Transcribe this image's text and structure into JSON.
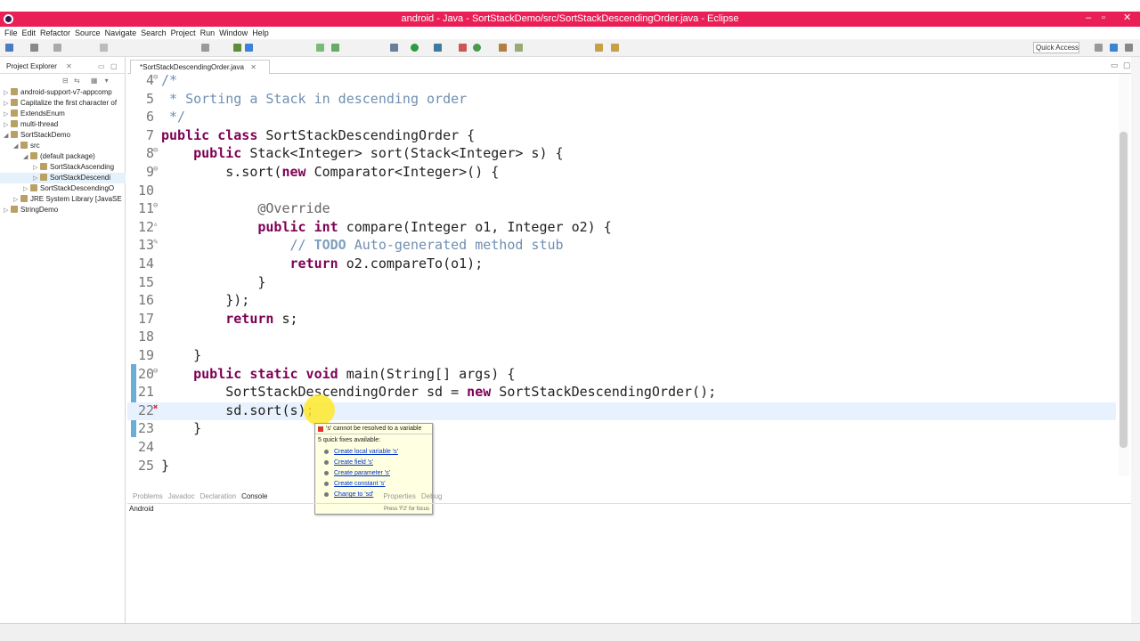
{
  "window": {
    "title": "android - Java - SortStackDemo/src/SortStackDescendingOrder.java - Eclipse",
    "minimize": "–",
    "maximize": "▫",
    "close": "✕"
  },
  "menu": [
    "File",
    "Edit",
    "Refactor",
    "Source",
    "Navigate",
    "Search",
    "Project",
    "Run",
    "Window",
    "Help"
  ],
  "quick_access": "Quick Access",
  "project_explorer": {
    "tab": "Project Explorer",
    "items": [
      {
        "label": "android-support-v7-appcomp",
        "indent": 1
      },
      {
        "label": "Capitalize the first character of",
        "indent": 1
      },
      {
        "label": "ExtendsEnum",
        "indent": 1
      },
      {
        "label": "multi-thread",
        "indent": 1
      },
      {
        "label": "SortStackDemo",
        "indent": 1
      },
      {
        "label": "src",
        "indent": 2
      },
      {
        "label": "(default package)",
        "indent": 3
      },
      {
        "label": "SortStackAscending",
        "indent": 4
      },
      {
        "label": "SortStackDescendi",
        "indent": 4
      },
      {
        "label": "SortStackDescendingO",
        "indent": 3
      },
      {
        "label": "JRE System Library [JavaSE",
        "indent": 2
      },
      {
        "label": "StringDemo",
        "indent": 1
      }
    ]
  },
  "editor": {
    "tab": "*SortStackDescendingOrder.java",
    "lines": [
      {
        "n": "4",
        "marker": "⊖",
        "html": "/*",
        "cls": "c"
      },
      {
        "n": "5",
        "html": " * Sorting a Stack in descending order",
        "cls": "c"
      },
      {
        "n": "6",
        "html": " */",
        "cls": "c"
      },
      {
        "n": "7",
        "parts": [
          [
            "k",
            "public class "
          ],
          [
            "",
            "SortStackDescendingOrder {"
          ]
        ]
      },
      {
        "n": "8",
        "marker": "⊖",
        "parts": [
          [
            "",
            "    "
          ],
          [
            "k",
            "public "
          ],
          [
            "",
            "Stack<Integer> sort(Stack<Integer> s) {"
          ]
        ]
      },
      {
        "n": "9",
        "marker": "⊖",
        "parts": [
          [
            "",
            "        s.sort("
          ],
          [
            "k",
            "new "
          ],
          [
            "",
            "Comparator<Integer>() {"
          ]
        ]
      },
      {
        "n": "10",
        "parts": []
      },
      {
        "n": "11",
        "marker": "⊖",
        "parts": [
          [
            "a",
            "            @Override"
          ]
        ]
      },
      {
        "n": "12",
        "marker": "▵",
        "parts": [
          [
            "",
            "            "
          ],
          [
            "k",
            "public int "
          ],
          [
            "",
            "compare(Integer o1, Integer o2) {"
          ]
        ]
      },
      {
        "n": "13",
        "marker": "✎",
        "parts": [
          [
            "c",
            "                // "
          ],
          [
            "t",
            "TODO"
          ],
          [
            "c",
            " Auto-generated method stub"
          ]
        ]
      },
      {
        "n": "14",
        "parts": [
          [
            "",
            "                "
          ],
          [
            "k",
            "return "
          ],
          [
            "",
            "o2.compareTo(o1);"
          ]
        ]
      },
      {
        "n": "15",
        "parts": [
          [
            "",
            "            }"
          ]
        ]
      },
      {
        "n": "16",
        "parts": [
          [
            "",
            "        });"
          ]
        ]
      },
      {
        "n": "17",
        "parts": [
          [
            "",
            "        "
          ],
          [
            "k",
            "return "
          ],
          [
            "",
            "s;"
          ]
        ]
      },
      {
        "n": "18",
        "parts": []
      },
      {
        "n": "19",
        "parts": [
          [
            "",
            "    }"
          ]
        ]
      },
      {
        "n": "20",
        "marker": "⊖",
        "parts": [
          [
            "",
            "    "
          ],
          [
            "k",
            "public static void "
          ],
          [
            "",
            "main(String[] args) {"
          ]
        ]
      },
      {
        "n": "21",
        "parts": [
          [
            "",
            "        SortStackDescendingOrder sd = "
          ],
          [
            "k",
            "new "
          ],
          [
            "",
            "SortStackDescendingOrder();"
          ]
        ]
      },
      {
        "n": "22",
        "marker": "✖",
        "parts": [
          [
            "",
            "        sd.sort(s);"
          ]
        ]
      },
      {
        "n": "23",
        "parts": [
          [
            "",
            "    }"
          ]
        ]
      },
      {
        "n": "24",
        "parts": []
      },
      {
        "n": "25",
        "parts": [
          [
            "",
            "}"
          ]
        ]
      }
    ]
  },
  "quickfix": {
    "error": "'s' cannot be resolved to a variable",
    "count_text": "5 quick fixes available:",
    "fixes": [
      "Create local variable 's'",
      "Create field 's'",
      "Create parameter 's'",
      "Create constant 's'",
      "Change to 'sd'"
    ],
    "footer": "Press 'F2' for focus"
  },
  "bottom": {
    "tabs": [
      "Problems",
      "Javadoc",
      "Declaration",
      "Console",
      "Properties",
      "Debug"
    ],
    "active": "Console",
    "console_label": "Android"
  }
}
